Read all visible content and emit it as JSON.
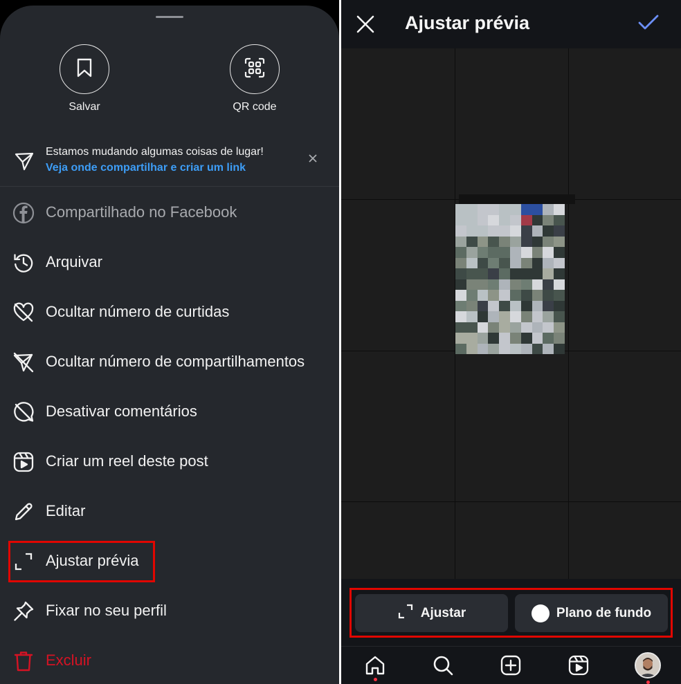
{
  "left_panel": {
    "top_actions": [
      {
        "label": "Salvar",
        "icon": "bookmark-icon"
      },
      {
        "label": "QR code",
        "icon": "qr-code-icon"
      }
    ],
    "notice": {
      "text": "Estamos mudando algumas coisas de lugar!",
      "link": "Veja onde compartilhar e criar um link",
      "icon": "paper-plane-icon"
    },
    "menu": [
      {
        "label": "Compartilhado no Facebook",
        "icon": "facebook-icon",
        "state": "disabled"
      },
      {
        "label": "Arquivar",
        "icon": "archive-history-icon"
      },
      {
        "label": "Ocultar número de curtidas",
        "icon": "heart-off-icon"
      },
      {
        "label": "Ocultar número de compartilhamentos",
        "icon": "share-off-icon"
      },
      {
        "label": "Desativar comentários",
        "icon": "comment-off-icon"
      },
      {
        "label": "Criar um reel deste post",
        "icon": "reel-icon"
      },
      {
        "label": "Editar",
        "icon": "pencil-icon"
      },
      {
        "label": "Ajustar prévia",
        "icon": "crop-expand-icon",
        "highlighted": true
      },
      {
        "label": "Fixar no seu perfil",
        "icon": "pin-icon"
      },
      {
        "label": "Excluir",
        "icon": "trash-icon",
        "state": "danger"
      }
    ]
  },
  "right_panel": {
    "title": "Ajustar prévia",
    "options": {
      "adjust_label": "Ajustar",
      "background_label": "Plano de fundo"
    },
    "nav": [
      "home-icon",
      "search-icon",
      "create-icon",
      "reels-icon",
      "profile-avatar"
    ]
  },
  "colors": {
    "accent_blue": "#3d9df6",
    "check_blue": "#6c8ff7",
    "danger_red": "#d51324",
    "highlight_red": "#e10600",
    "sheet_bg": "#25282d",
    "right_bg": "#131519"
  }
}
